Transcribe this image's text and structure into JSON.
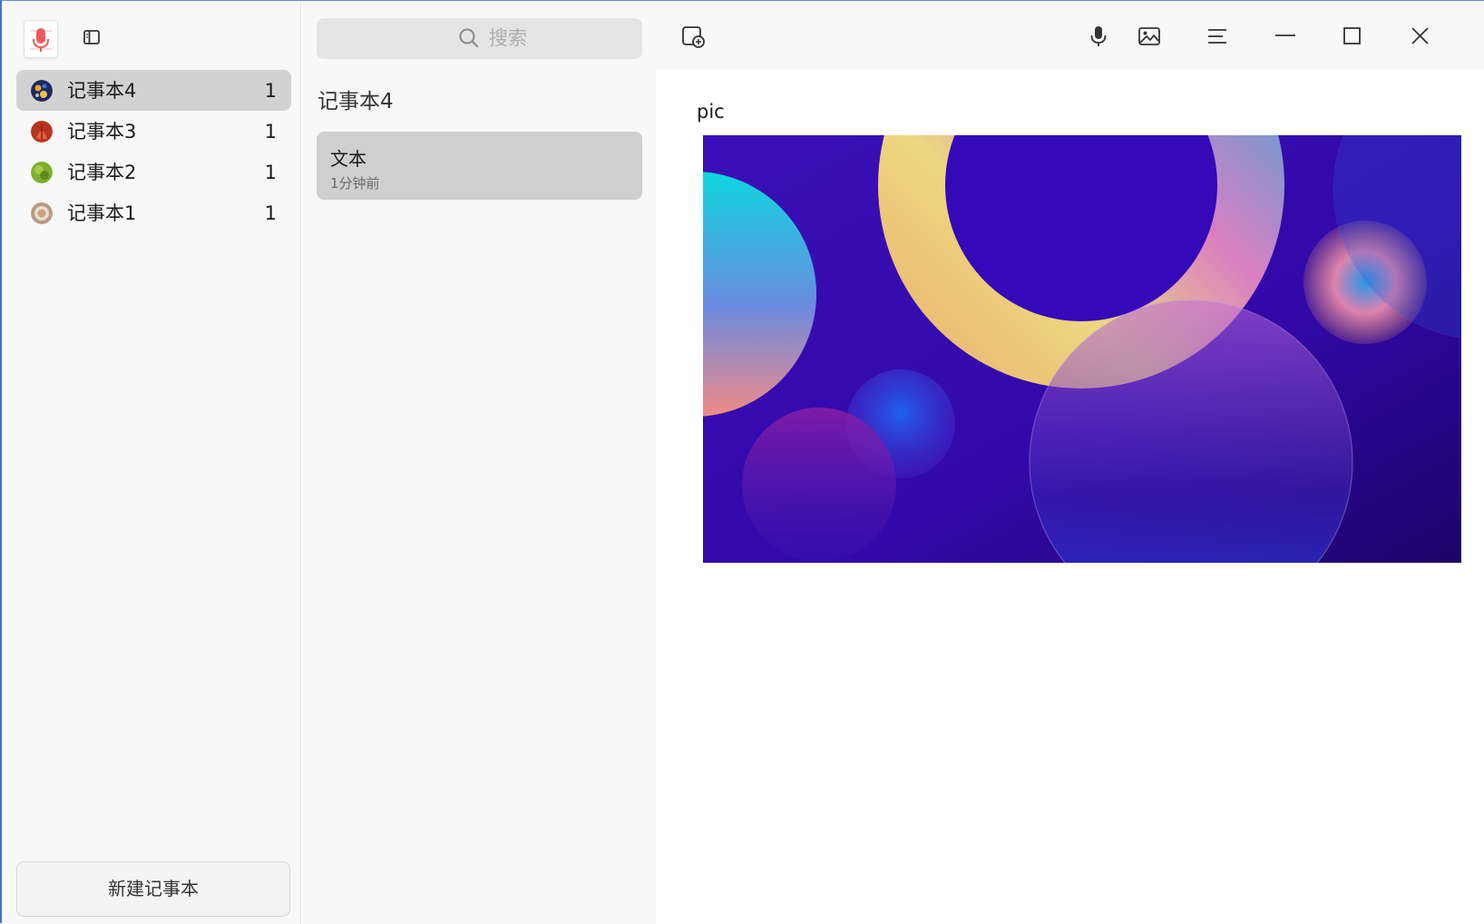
{
  "app": {
    "logo_icon": "microphone-notepad-icon",
    "toggle_icon": "sidebar-toggle-icon"
  },
  "sidebar": {
    "notebooks": [
      {
        "name": "记事本4",
        "count": "1",
        "active": true,
        "avatar_color": "#1d2a5e"
      },
      {
        "name": "记事本3",
        "count": "1",
        "active": false,
        "avatar_color": "#b8341e"
      },
      {
        "name": "记事本2",
        "count": "1",
        "active": false,
        "avatar_color": "#7fae2e"
      },
      {
        "name": "记事本1",
        "count": "1",
        "active": false,
        "avatar_color": "#b59a85"
      }
    ],
    "new_notebook_label": "新建记事本"
  },
  "list": {
    "search_placeholder": "搜索",
    "notebook_title": "记事本4",
    "notes": [
      {
        "title": "文本",
        "time": "1分钟前"
      }
    ]
  },
  "toolbar": {
    "icons": [
      "new-note-icon",
      "microphone-icon",
      "image-icon",
      "menu-icon",
      "minimize-icon",
      "maximize-icon",
      "close-icon"
    ]
  },
  "editor": {
    "text": "pic",
    "image_label": "abstract-gradient-bubbles-wallpaper"
  },
  "colors": {
    "accent": "#3a76c9",
    "selected": "#d2d2d2",
    "panel_bg": "#f8f8f8"
  }
}
